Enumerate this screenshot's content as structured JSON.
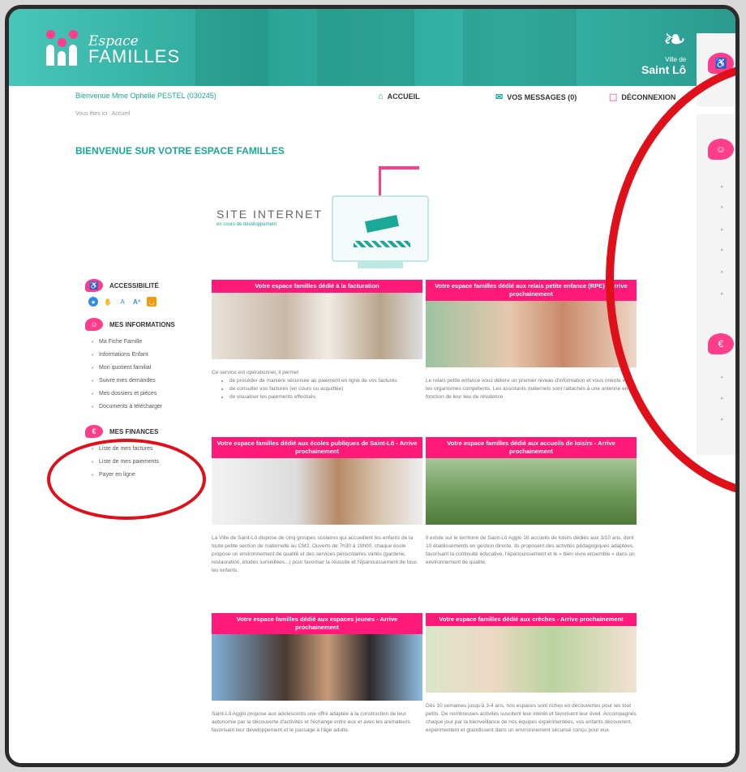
{
  "banner": {
    "logo_line1": "Espace",
    "logo_line2": "FAMILLES",
    "city_prefix": "Ville de",
    "city_name": "Saint Lô"
  },
  "topbar": {
    "welcome": "Bienvenue Mme Ophelie PESTEL (030245)",
    "home": "ACCUEIL",
    "messages": "VOS MESSAGES (0)",
    "logout": "DÉCONNEXION"
  },
  "breadcrumb": "Vous êtes ici : Accueil",
  "page_title": "BIENVENUE SUR VOTRE ESPACE FAMILLES",
  "hero": {
    "line1": "SITE INTERNET",
    "line2": "en cours de développement"
  },
  "sidebar": {
    "accessibility": {
      "title": "ACCESSIBILITÉ"
    },
    "informations": {
      "title": "MES INFORMATIONS",
      "items": [
        "Ma Fiche Famille",
        "Informations Enfant",
        "Mon quotient familial",
        "Suivre mes demandes",
        "Mes dossiers et pièces",
        "Documents à télécharger"
      ]
    },
    "finances": {
      "title": "MES FINANCES",
      "items": [
        "Liste de mes factures",
        "Liste de mes paiements",
        "Payer en ligne"
      ]
    }
  },
  "cards": [
    {
      "title": "Votre espace familles dédié à la facturation",
      "intro": "Ce service est opérationnel, il permet",
      "bullets": [
        "de procéder de manière sécurisée au paiement en ligne de vos factures",
        "de consulter vos factures (en cours ou acquittée)",
        "de visualiser les paiements effectués"
      ]
    },
    {
      "title": "Votre espace familles dédié aux relais petite enfance (RPE) - Arrive prochainement",
      "text": "Le relais petite enfance vous délivre un premier niveau d'information et vous oriente vers les organismes compétents. Les assistants maternels sont rattachés à une antenne en fonction de leur lieu de résidence"
    },
    {
      "title": "Votre espace familles dédié aux écoles publiques de Saint-Lô - Arrive prochainement",
      "text": "La Ville de Saint-Lô dispose de cinq groupes scolaires qui accueillent les enfants de la toute petite section de maternelle au CM2. Ouverts de 7h30 à 19h00, chaque école propose un environnement de qualité et des services périscolaires variés (garderie, restauration, études surveillées...) pour favoriser la réussite et l'épanouissement de tous les enfants."
    },
    {
      "title": "Votre espace familles dédié aux accueils de loisirs - Arrive prochainement",
      "text": "Il existe sur le territoire de Saint-Lô Agglo 16 accueils de loisirs dédiés aux 3/10 ans, dont 10 établissements en gestion directe. Ils proposent des activités pédagogiques adaptées, favorisant la continuité éducative, l'épanouissement et le « bien vivre ensemble » dans un environnement de qualité."
    },
    {
      "title": "Votre espace familles dédié aux espaces jeunes - Arrive prochainement",
      "text": "Saint-Lô Agglo propose aux adolescents une offre adaptée à la construction de leur autonomie par la découverte d'activités et l'échange entre eux et avec les animateurs favorisant leur développement et le passage à l'âge adulte."
    },
    {
      "title": "Votre espace familles dédié aux crèches - Arrive prochainement",
      "text": "Dès 10 semaines jusqu'à 3-4 ans, nos espaces sont riches en découvertes pour les tout petits. De nombreuses activités suscitent leur intérêt et favorisent leur éveil. Accompagnés chaque jour par la bienveillance de nos équipes expérimentées, vos enfants découvrent, expérimentent et grandissent dans un environnement sécurisé conçu pour eux."
    }
  ],
  "colors": {
    "teal": "#1aa897",
    "pink": "#ff1a7a",
    "annotation_red": "#e0101a"
  }
}
